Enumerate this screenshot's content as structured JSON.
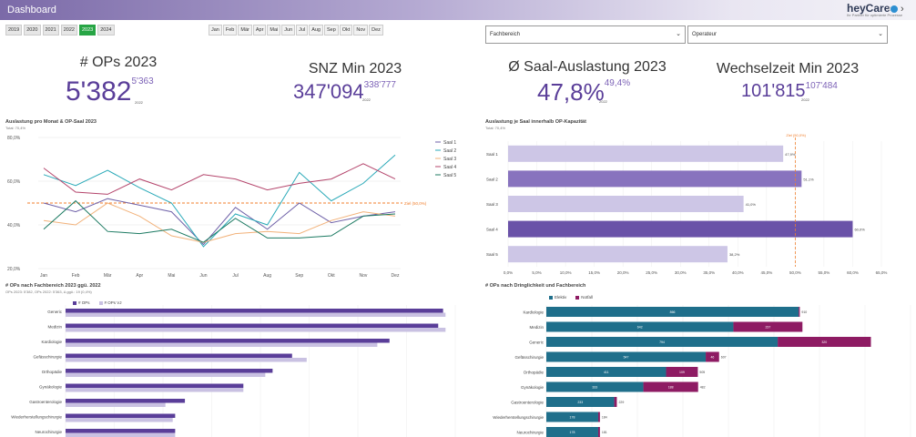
{
  "app": {
    "title": "Dashboard",
    "logo": "heyCare",
    "logo_sub": "Ihr Partner für optimierte Prozesse"
  },
  "years": [
    "2019",
    "2020",
    "2021",
    "2022",
    "2023",
    "2024"
  ],
  "active_year": "2023",
  "months": [
    "Jan",
    "Feb",
    "Mär",
    "Apr",
    "Mai",
    "Jun",
    "Jul",
    "Aug",
    "Sep",
    "Okt",
    "Nov",
    "Dez"
  ],
  "filters": {
    "fachbereich": "Fachbereich",
    "operateur": "Operateur"
  },
  "kpis": {
    "ops": {
      "title": "# OPs 2023",
      "value": "5'382",
      "prev": "5'363",
      "prev_year": "2022"
    },
    "snz": {
      "title": "SNZ Min 2023",
      "value": "347'094",
      "prev": "338'777",
      "prev_year": "2022"
    },
    "saal": {
      "title": "Ø Saal-Auslastung 2023",
      "value": "47,8%",
      "prev": "49,4%",
      "prev_year": "2022"
    },
    "wechsel": {
      "title": "Wechselzeit Min 2023",
      "value": "101'815",
      "prev": "107'484",
      "prev_year": "2022"
    }
  },
  "sections": {
    "line": {
      "title": "Auslastung pro Monat & OP-Saal 2023",
      "sub": "Total: 70,4%"
    },
    "saal": {
      "title": "Auslastung je Saal innerhalb OP-Kapazität",
      "sub": "Total: 70,4%"
    },
    "fach": {
      "title": "# OPs nach Fachbereich 2023 ggü. 2022",
      "sub": "OPs 2023: 5'382, OPs 2022: 5'363, Δ ggü.: 19 (0,4%)"
    },
    "dring": {
      "title": "# OPs nach Dringlichkeit und Fachbereich"
    }
  },
  "colors": {
    "purple_dark": "#5a3e99",
    "purple_light": "#c9c1e2",
    "teal": "#1f6f8b",
    "magenta": "#8e1b63",
    "target": "#f07f2d"
  },
  "chart_data": [
    {
      "type": "line",
      "title": "Auslastung pro Monat & OP-Saal 2023",
      "subtitle": "Total: 70,4%",
      "categories": [
        "Jan",
        "Feb",
        "Mär",
        "Apr",
        "Mai",
        "Jun",
        "Jul",
        "Aug",
        "Sep",
        "Okt",
        "Nov",
        "Dez"
      ],
      "yticks": [
        "20,0%",
        "40,0%",
        "60,0%",
        "80,0%"
      ],
      "ylim": [
        20,
        80
      ],
      "target": {
        "value": 50,
        "label": "Ziel (50,0%)"
      },
      "legend": "right",
      "series": [
        {
          "name": "Saal 1",
          "color": "#6f61a8",
          "values": [
            50,
            46,
            52,
            49,
            46,
            31,
            48,
            38,
            50,
            41,
            44,
            46
          ]
        },
        {
          "name": "Saal 2",
          "color": "#29a9b8",
          "values": [
            63,
            58,
            65,
            57,
            50,
            30,
            45,
            40,
            64,
            51,
            59,
            72
          ]
        },
        {
          "name": "Saal 3",
          "color": "#f2b27a",
          "values": [
            42,
            40,
            50,
            44,
            35,
            32,
            36,
            37,
            36,
            42,
            46,
            44
          ]
        },
        {
          "name": "Saal 4",
          "color": "#b4446b",
          "values": [
            66,
            55,
            54,
            61,
            56,
            63,
            61,
            56,
            59,
            61,
            68,
            61
          ]
        },
        {
          "name": "Saal 5",
          "color": "#1c7a62",
          "values": [
            38,
            51,
            37,
            36,
            38,
            32,
            43,
            34,
            34,
            35,
            44,
            45
          ]
        }
      ]
    },
    {
      "type": "bar",
      "title": "Auslastung je Saal innerhalb OP-Kapazität",
      "subtitle": "Total: 70,4%",
      "categories": [
        "Saal 1",
        "Saal 2",
        "Saal 3",
        "Saal 4",
        "Saal 5"
      ],
      "values": [
        47.9,
        51.1,
        41.0,
        60.0,
        38.2
      ],
      "labels": [
        "47,9%",
        "51,1%",
        "41,0%",
        "60,0%",
        "38,2%"
      ],
      "highlight": [
        false,
        true,
        false,
        true,
        false
      ],
      "xticks": [
        "0,0%",
        "5,0%",
        "10,0%",
        "15,0%",
        "20,0%",
        "25,0%",
        "30,0%",
        "35,0%",
        "40,0%",
        "45,0%",
        "50,0%",
        "55,0%",
        "60,0%",
        "65,0%"
      ],
      "xlim": [
        0,
        65
      ],
      "target": {
        "value": 50,
        "label": "Ziel (50,0%)"
      }
    },
    {
      "type": "bar",
      "title": "# OPs nach Fachbereich 2023 ggü. 2022",
      "categories": [
        "Generic",
        "Medizin",
        "Kardiologie",
        "Gefässchirurgie",
        "Orthopädie",
        "Gynäkologie",
        "Gastroenterologie",
        "Wiederherstellungschirurgie",
        "Neurochirurgie"
      ],
      "series": [
        {
          "name": "# OPs",
          "color": "#5a3e99",
          "values": [
            1550,
            1530,
            1330,
            930,
            850,
            730,
            490,
            450,
            450
          ]
        },
        {
          "name": "# OPs VJ",
          "color": "#c9c1e2",
          "values": [
            1560,
            1560,
            1280,
            990,
            820,
            730,
            410,
            440,
            450
          ]
        }
      ],
      "xlim": [
        0,
        1600
      ],
      "legend": "top-left"
    },
    {
      "type": "bar",
      "stacked": true,
      "title": "# OPs nach Dringlichkeit und Fachbereich",
      "categories": [
        "Kardiologie",
        "Medizin",
        "Generic",
        "Gefässchirurgie",
        "Orthopädie",
        "Gynäkologie",
        "Gastroenterologie",
        "Wiederherstellungschirurgie",
        "Neurochirurgie"
      ],
      "series": [
        {
          "name": "Elektiv",
          "color": "#1f6f8b",
          "values": [
            866,
            642,
            794,
            547,
            411,
            333,
            233,
            178,
            178
          ]
        },
        {
          "name": "Notfall",
          "color": "#8e1b63",
          "values": [
            4,
            237,
            320,
            46,
            109,
            188,
            9,
            6,
            6
          ]
        }
      ],
      "totals": [
        "910",
        "",
        "",
        "607",
        "505",
        "482",
        "229",
        "184",
        "181"
      ],
      "xlim": [
        0,
        1250
      ],
      "legend": "top-left"
    }
  ]
}
